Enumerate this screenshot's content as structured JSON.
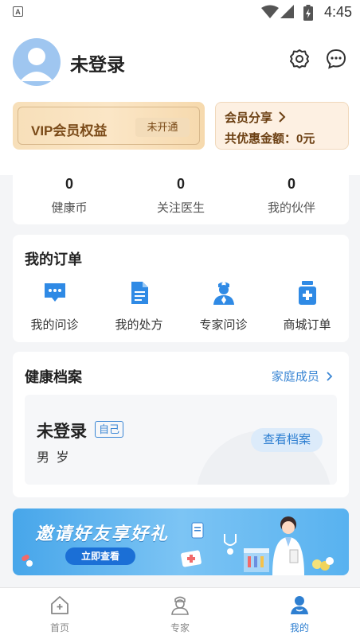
{
  "status_bar": {
    "time": "4:45"
  },
  "profile": {
    "username": "未登录"
  },
  "vip": {
    "title": "VIP会员权益",
    "button": "未开通"
  },
  "share": {
    "title": "会员分享",
    "amount": "共优惠金额：0元"
  },
  "stats": [
    {
      "value": "0",
      "label": "健康币"
    },
    {
      "value": "0",
      "label": "关注医生"
    },
    {
      "value": "0",
      "label": "我的伙伴"
    }
  ],
  "orders": {
    "title": "我的订单",
    "items": [
      {
        "label": "我的问诊",
        "icon": "chat-icon"
      },
      {
        "label": "我的处方",
        "icon": "prescription-icon"
      },
      {
        "label": "专家问诊",
        "icon": "doctor-icon"
      },
      {
        "label": "商城订单",
        "icon": "medicine-bottle-icon"
      }
    ]
  },
  "health": {
    "title": "健康档案",
    "family_link": "家庭成员",
    "record": {
      "name": "未登录",
      "tag": "自己",
      "info": "男 岁",
      "button": "查看档案"
    }
  },
  "banner": {
    "title": "邀请好友享好礼",
    "button": "立即查看"
  },
  "tabs": [
    {
      "label": "首页",
      "icon": "home-icon",
      "active": false
    },
    {
      "label": "专家",
      "icon": "expert-icon",
      "active": false
    },
    {
      "label": "我的",
      "icon": "profile-icon",
      "active": true
    }
  ],
  "colors": {
    "accent": "#2e7fd1",
    "vip_text": "#7a4a18"
  }
}
